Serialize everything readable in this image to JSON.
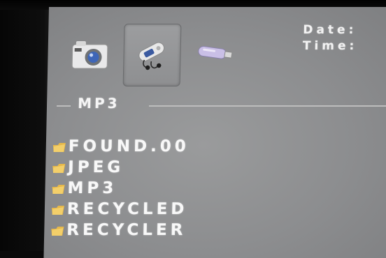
{
  "top_bar": {
    "date_label": "Date:",
    "time_label": "Time:"
  },
  "mode_icons": [
    {
      "name": "camera-icon",
      "selected": false
    },
    {
      "name": "mp3-player-icon",
      "selected": true
    },
    {
      "name": "usb-drive-icon",
      "selected": false
    }
  ],
  "section": {
    "title": "MP3"
  },
  "folders": [
    {
      "name": "FOUND.00"
    },
    {
      "name": "JPEG"
    },
    {
      "name": "MP3"
    },
    {
      "name": "RECYCLED"
    },
    {
      "name": "RECYCLER"
    }
  ],
  "colors": {
    "screen_bg": "#8e8f91",
    "text": "#f5f5f5",
    "folder_icon": "#e6b84a"
  }
}
